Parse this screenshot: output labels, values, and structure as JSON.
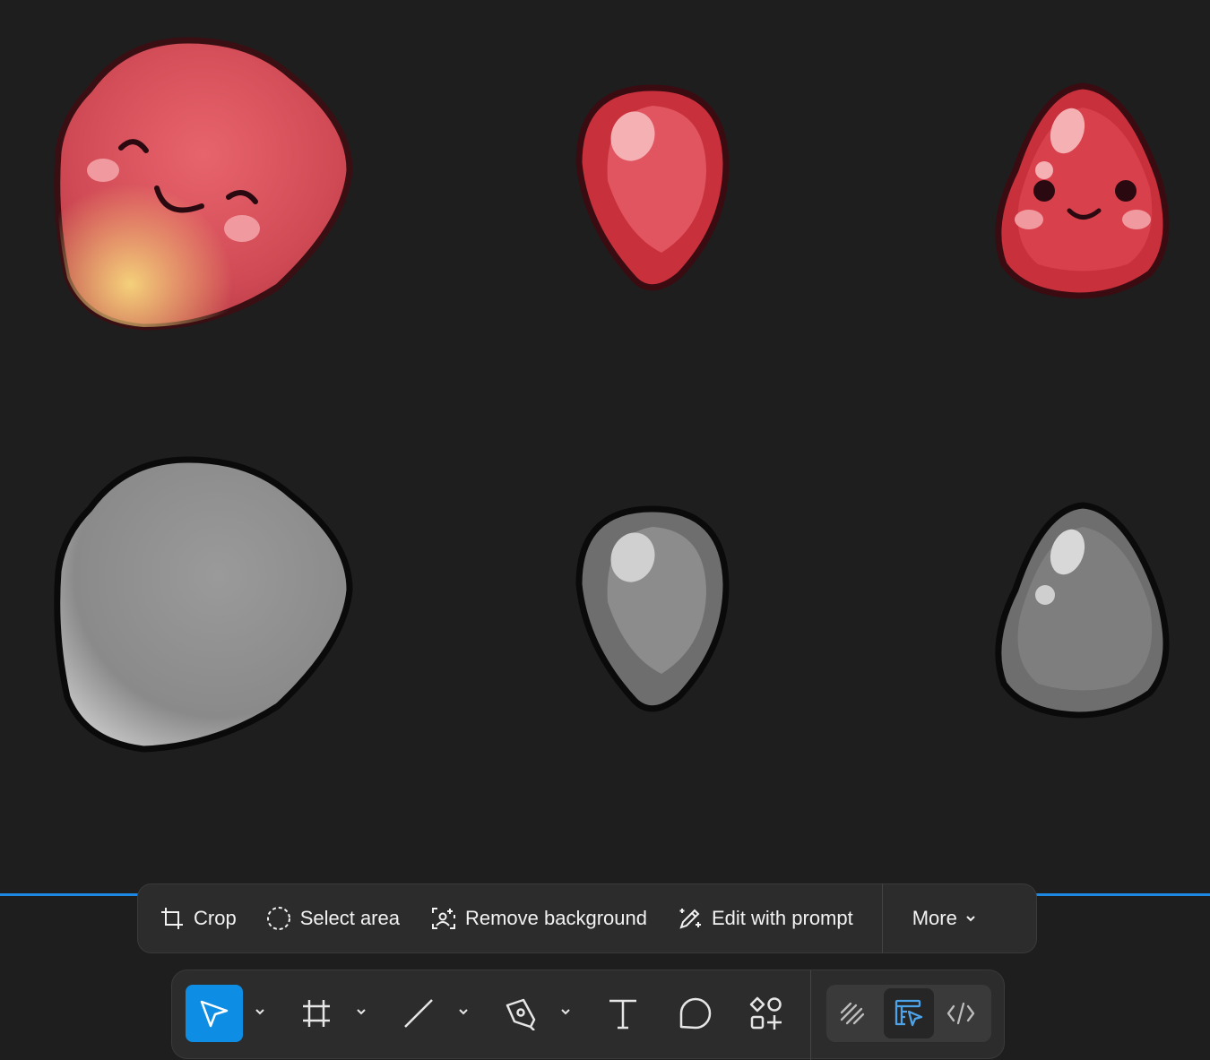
{
  "image_toolbar": {
    "crop": "Crop",
    "select_area": "Select area",
    "remove_background": "Remove background",
    "edit_with_prompt": "Edit with prompt",
    "more": "More"
  },
  "main_toolbar": {
    "tools": [
      "move-tool",
      "frame-tool",
      "line-tool",
      "pen-tool",
      "text-tool",
      "comment-tool",
      "actions-tool"
    ],
    "modes": [
      "draw-mode",
      "design-mode",
      "dev-mode"
    ],
    "selected_tool": "move-tool",
    "selected_mode": "design-mode"
  },
  "colors": {
    "canvas_bg": "#1e1e1e",
    "accent": "#0d8de3",
    "toolbar_bg": "#2c2c2c",
    "selection_line": "#1e88e5"
  }
}
